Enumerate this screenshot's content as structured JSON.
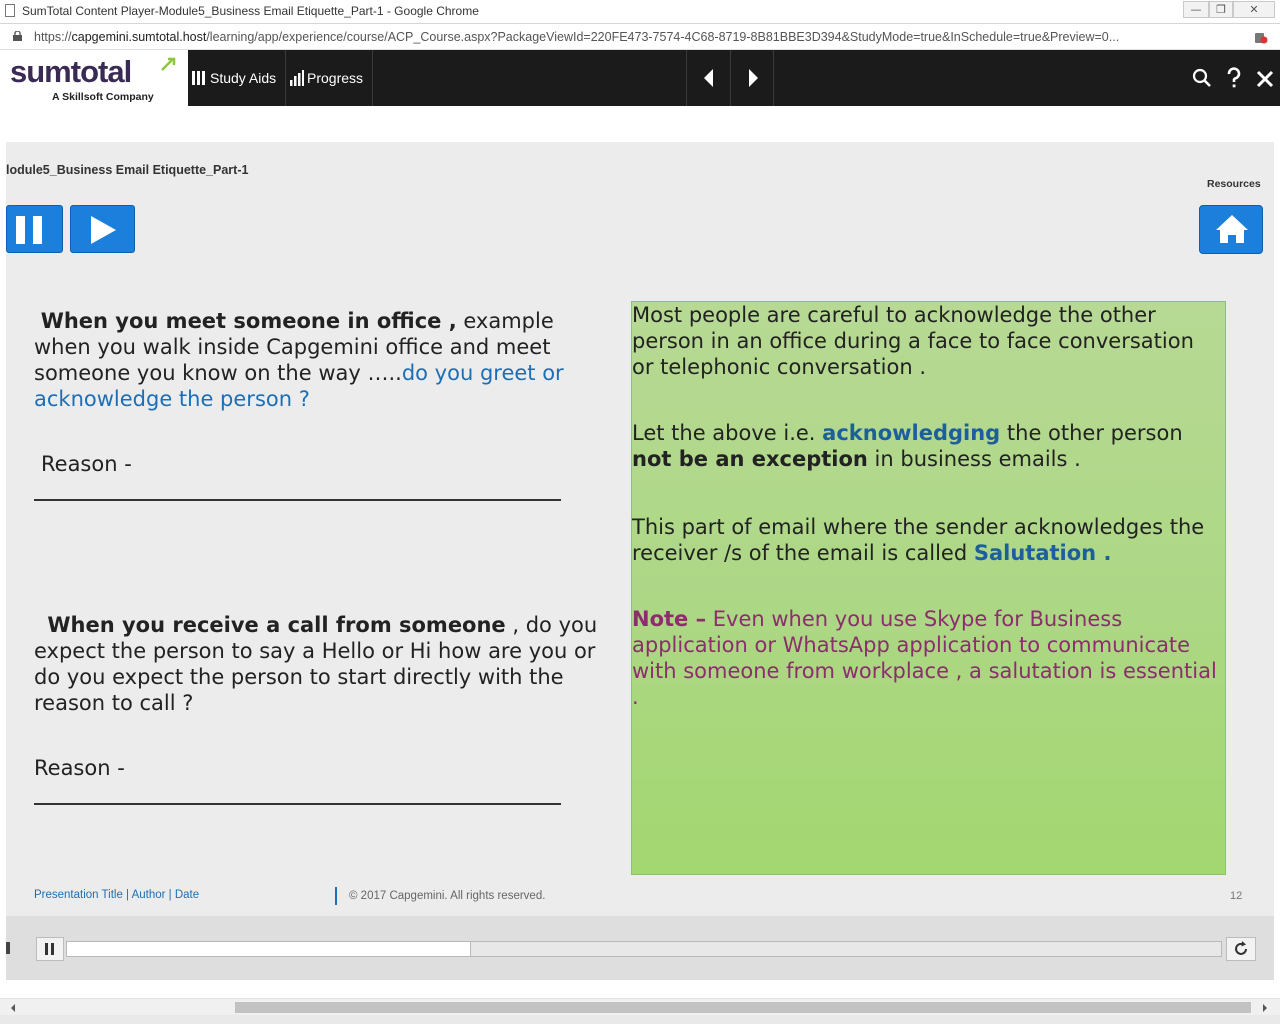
{
  "window": {
    "title": "SumTotal Content Player-Module5_Business Email Etiquette_Part-1 - Google Chrome",
    "minimize_symbol": "—",
    "maximize_symbol": "❐",
    "close_symbol": "✕"
  },
  "address_bar": {
    "scheme": "https://",
    "host": "capgemini.sumtotal.host",
    "path": "/learning/app/experience/course/ACP_Course.aspx?PackageViewId=220FE473-7574-4C68-8719-8B81BBE3D394&StudyMode=true&InSchedule=true&Preview=0..."
  },
  "app_nav": {
    "logo_text": "sumtotal",
    "logo_subtitle": "A Skillsoft Company",
    "study_aids_label": "Study Aids",
    "progress_label": "Progress",
    "icons": [
      "prev-arrow-icon",
      "next-arrow-icon",
      "search-icon",
      "help-icon",
      "close-icon"
    ]
  },
  "slide": {
    "module_title": "lodule5_Business Email Etiquette_Part-1",
    "resources_label": "Resources",
    "question1": {
      "lead": "When you meet someone in office ,",
      "text": " example when you walk inside Capgemini office and meet someone you know on the way …..",
      "highlight": "do you greet or acknowledge the person ?"
    },
    "reason1": "Reason -",
    "question2": {
      "lead": "When you receive a call from someone",
      "text": " , do you expect the person to say a Hello or Hi how are you or do you expect the person to start directly with the reason to call ?"
    },
    "reason2": "Reason -",
    "panel": {
      "p1": "Most people are careful to acknowledge the other person in an office during a face to face conversation or telephonic conversation .",
      "p2_a": "Let the above i.e. ",
      "p2_highlight": "acknowledging",
      "p2_b": " the other person ",
      "p2_strong": "not be an exception",
      "p2_c": " in business emails  .",
      "p3_a": "This part of email where the sender acknowledges the receiver /s of the email is called ",
      "p3_highlight": "Salutation .",
      "p4_lead": "Note –",
      "p4_text": " Even when you use Skype for Business application or WhatsApp application to communicate with someone from workplace , a salutation is essential ."
    },
    "footer_links": "Presentation Title | Author | Date",
    "copyright": "© 2017 Capgemini. All rights reserved.",
    "page_number": "12"
  },
  "player": {
    "progress_fraction": 0.35
  },
  "colors": {
    "accent_blue": "#1c7fdc",
    "nav_bg": "#1b1b1b",
    "panel_green": "#acd784",
    "note_purple": "#8c2d6d"
  }
}
